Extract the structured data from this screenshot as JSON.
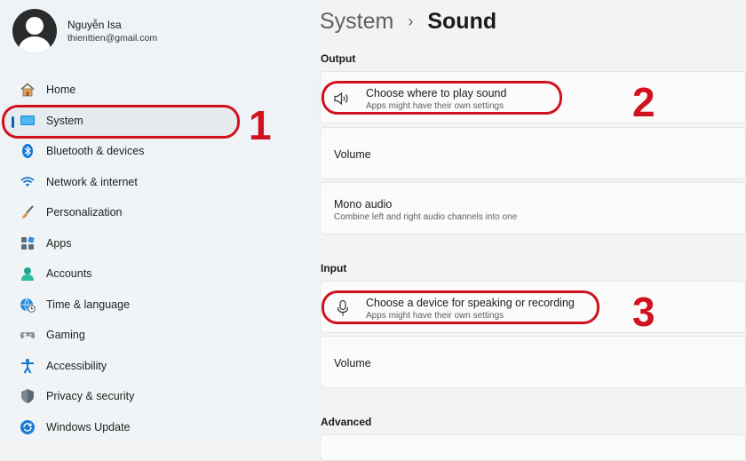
{
  "profile": {
    "name": "Nguyễn Isa",
    "email": "thienttien@gmail.com"
  },
  "nav": [
    {
      "label": "Home",
      "icon": "home-icon"
    },
    {
      "label": "System",
      "icon": "system-icon",
      "selected": true
    },
    {
      "label": "Bluetooth & devices",
      "icon": "bluetooth-icon"
    },
    {
      "label": "Network & internet",
      "icon": "wifi-icon"
    },
    {
      "label": "Personalization",
      "icon": "brush-icon"
    },
    {
      "label": "Apps",
      "icon": "apps-icon"
    },
    {
      "label": "Accounts",
      "icon": "person-icon"
    },
    {
      "label": "Time & language",
      "icon": "globe-clock-icon"
    },
    {
      "label": "Gaming",
      "icon": "gamepad-icon"
    },
    {
      "label": "Accessibility",
      "icon": "accessibility-icon"
    },
    {
      "label": "Privacy & security",
      "icon": "shield-icon"
    },
    {
      "label": "Windows Update",
      "icon": "update-icon"
    }
  ],
  "breadcrumb": {
    "parent": "System",
    "separator": "›",
    "current": "Sound"
  },
  "output": {
    "title": "Output",
    "choose": {
      "title": "Choose where to play sound",
      "subtitle": "Apps might have their own settings",
      "icon": "speaker-icon"
    },
    "volume": {
      "title": "Volume"
    },
    "mono": {
      "title": "Mono audio",
      "subtitle": "Combine left and right audio channels into one"
    }
  },
  "input": {
    "title": "Input",
    "choose": {
      "title": "Choose a device for speaking or recording",
      "subtitle": "Apps might have their own settings",
      "icon": "microphone-icon"
    },
    "volume": {
      "title": "Volume"
    }
  },
  "advanced": {
    "title": "Advanced"
  },
  "annotations": {
    "one": "1",
    "two": "2",
    "three": "3",
    "color": "#d1121e"
  },
  "colors": {
    "accent": "#0067c0"
  }
}
